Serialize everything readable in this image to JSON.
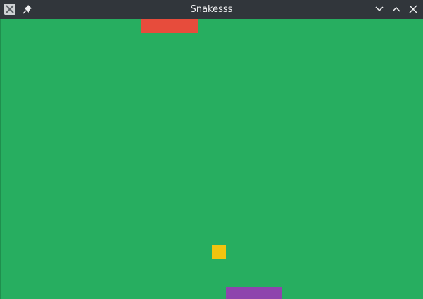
{
  "window": {
    "title": "Snakesss",
    "titlebar_color": "#31363b",
    "title_color": "#eff0f1",
    "icons": {
      "app": "app-icon",
      "pin": "pin-icon",
      "minimize": "chevron-down-icon",
      "maximize": "chevron-up-icon",
      "close": "close-icon"
    }
  },
  "game": {
    "board_color": "#27ae60",
    "snakes": [
      {
        "name": "red-snake",
        "color": "#e74c3c"
      },
      {
        "name": "purple-snake",
        "color": "#8e44ad"
      }
    ],
    "food": {
      "color": "#f1c40f"
    }
  }
}
